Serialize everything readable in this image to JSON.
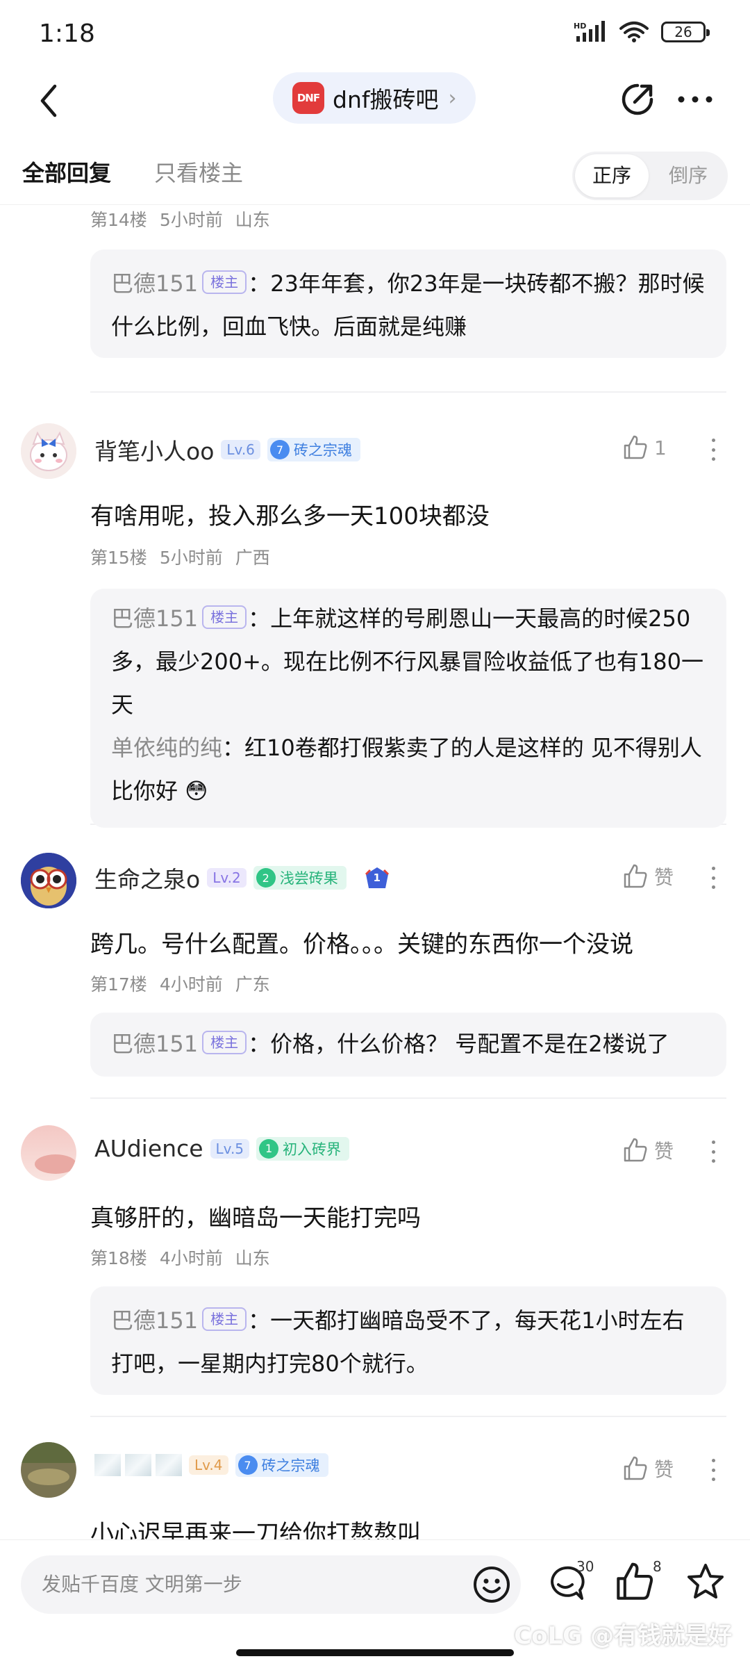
{
  "status": {
    "time": "1:18",
    "signal": "HD",
    "battery": "26"
  },
  "nav": {
    "forum_logo": "DNF",
    "forum_name": "dnf搬砖吧",
    "chevron": "›"
  },
  "filter": {
    "tab_all": "全部回复",
    "tab_host": "只看楼主",
    "sort_asc": "正序",
    "sort_desc": "倒序"
  },
  "posts": [
    {
      "floor": "第14楼",
      "time": "5小时前",
      "location": "山东",
      "replies": [
        {
          "name": "巴德151",
          "host_tag": "楼主",
          "text": "23年年套，你23年是一块砖都不搬？那时候什么比例，回血飞快。后面就是纯赚"
        }
      ]
    },
    {
      "user": "背笔小人oo",
      "level": "Lv.6",
      "badge_num": "7",
      "badge": "砖之宗魂",
      "likes": "1",
      "content": "有啥用呢，投入那么多一天100块都没",
      "floor": "第15楼",
      "time": "5小时前",
      "location": "广西",
      "replies": [
        {
          "name": "巴德151",
          "host_tag": "楼主",
          "text": "上年就这样的号刷恩山一天最高的时候250多，最少200+。现在比例不行风暴冒险收益低了也有180一天"
        },
        {
          "name": "单依纯的纯",
          "text": "红10卷都打假紫卖了的人是这样的 见不得别人比你好 😳"
        }
      ]
    },
    {
      "user": "生命之泉o",
      "level": "Lv.2",
      "badge_num": "2",
      "badge": "浅尝砖果",
      "extra_badge": "1",
      "likes": "赞",
      "content": "跨几。号什么配置。价格。。。关键的东西你一个没说",
      "floor": "第17楼",
      "time": "4小时前",
      "location": "广东",
      "replies": [
        {
          "name": "巴德151",
          "host_tag": "楼主",
          "text": "价格，什么价格？ 号配置不是在2楼说了"
        }
      ]
    },
    {
      "user": "AUdience",
      "level": "Lv.5",
      "badge_num": "1",
      "badge": "初入砖界",
      "likes": "赞",
      "content": "真够肝的，幽暗岛一天能打完吗",
      "floor": "第18楼",
      "time": "4小时前",
      "location": "山东",
      "replies": [
        {
          "name": "巴德151",
          "host_tag": "楼主",
          "text": "一天都打幽暗岛受不了，每天花1小时左右打吧，一星期内打完80个就行。"
        }
      ]
    },
    {
      "level": "Lv.4",
      "badge_num": "7",
      "badge": "砖之宗魂",
      "likes": "赞",
      "content": "小心迟早再来一刀给你打熬熬叫"
    }
  ],
  "bottom": {
    "placeholder": "发贴千百度 文明第一步",
    "comment_count": "30",
    "like_count": "8",
    "watermark": "CoLG @有钱就是好"
  }
}
